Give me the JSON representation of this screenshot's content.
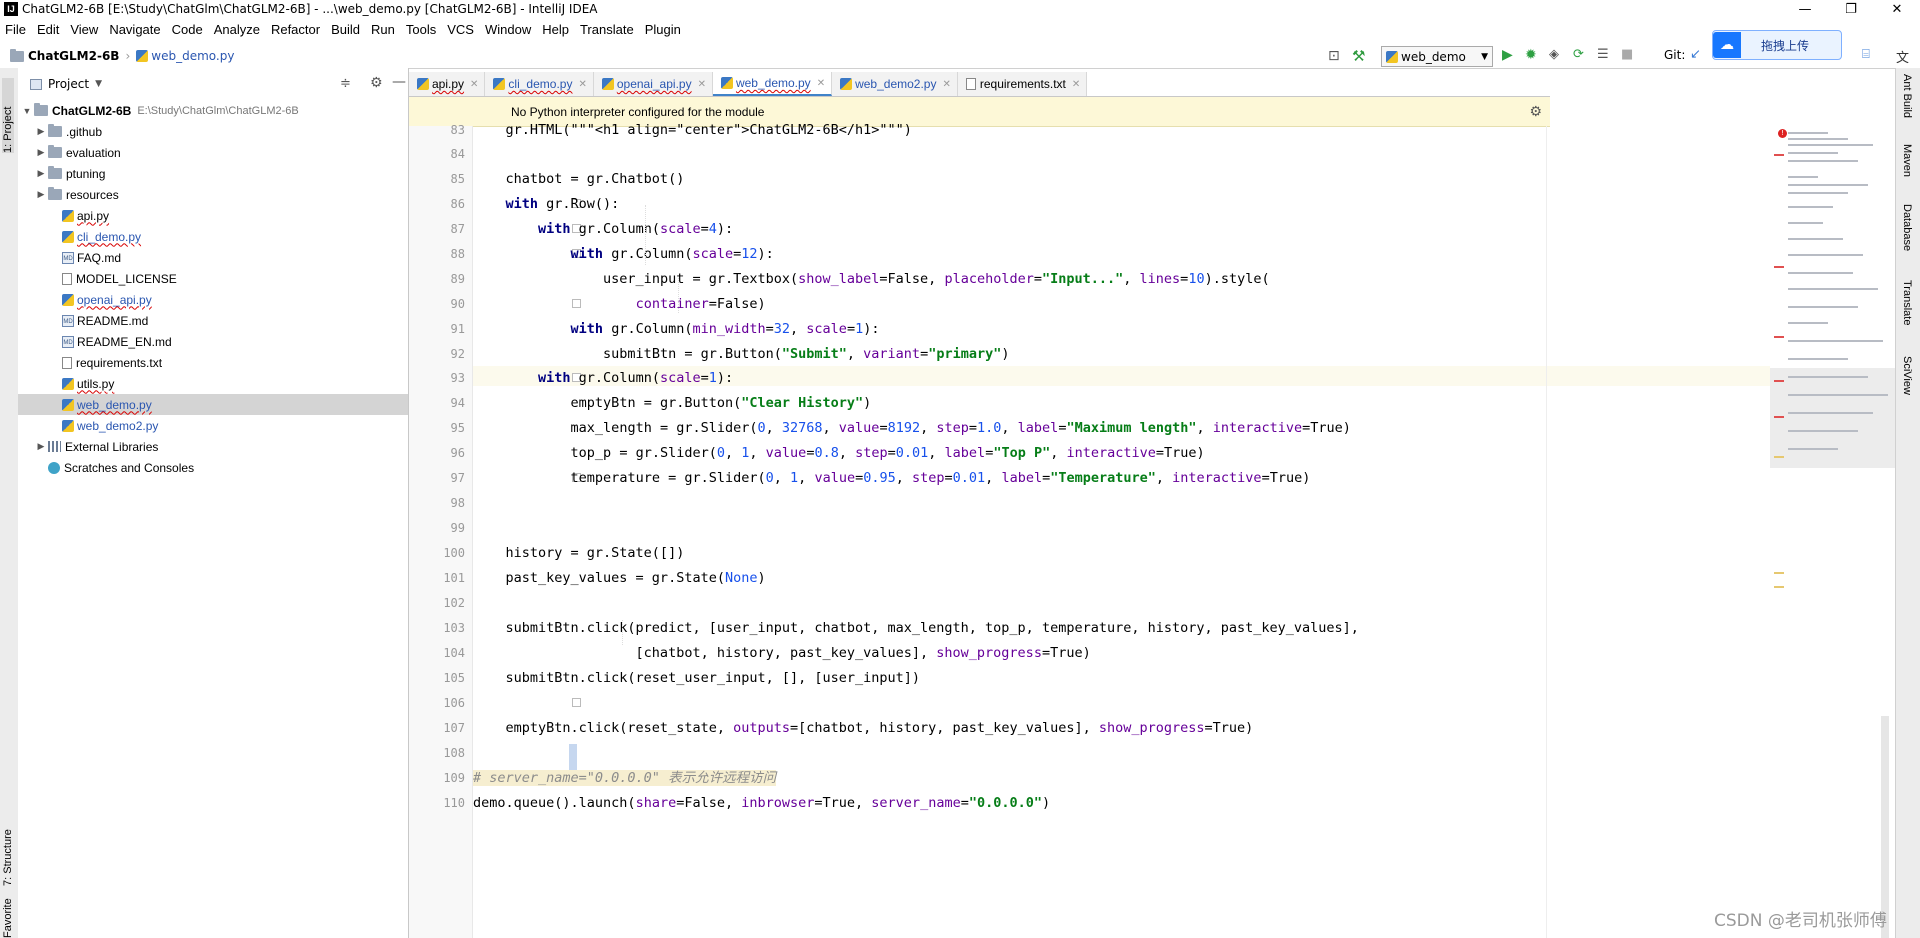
{
  "titlebar": {
    "title": "ChatGLM2-6B [E:\\Study\\ChatGlm\\ChatGLM2-6B] - ...\\web_demo.py [ChatGLM2-6B] - IntelliJ IDEA",
    "minimize": "—",
    "maximize": "❐",
    "close": "✕"
  },
  "menu": [
    "File",
    "Edit",
    "View",
    "Navigate",
    "Code",
    "Analyze",
    "Refactor",
    "Build",
    "Run",
    "Tools",
    "VCS",
    "Window",
    "Help",
    "Translate",
    "Plugin"
  ],
  "navbar": {
    "project": "ChatGLM2-6B",
    "file": "web_demo.py",
    "run_config": "web_demo",
    "git_label": "Git:"
  },
  "upload_badge": {
    "label": "拖拽上传",
    "color": "#1677ff"
  },
  "left_tools": {
    "project": "1: Project",
    "structure": "7: Structure",
    "favorites": "Favorites"
  },
  "right_tools": [
    "Ant Build",
    "Maven",
    "Database",
    "Translate",
    "SciView"
  ],
  "project_panel": {
    "title": "Project",
    "root": {
      "name": "ChatGLM2-6B",
      "path": "E:\\Study\\ChatGlm\\ChatGLM2-6B"
    },
    "items": [
      {
        "name": ".github",
        "type": "folder"
      },
      {
        "name": "evaluation",
        "type": "folder"
      },
      {
        "name": "ptuning",
        "type": "folder"
      },
      {
        "name": "resources",
        "type": "folder"
      },
      {
        "name": "api.py",
        "type": "py"
      },
      {
        "name": "cli_demo.py",
        "type": "py"
      },
      {
        "name": "FAQ.md",
        "type": "md"
      },
      {
        "name": "MODEL_LICENSE",
        "type": "txt"
      },
      {
        "name": "openai_api.py",
        "type": "py"
      },
      {
        "name": "README.md",
        "type": "md"
      },
      {
        "name": "README_EN.md",
        "type": "md"
      },
      {
        "name": "requirements.txt",
        "type": "txt"
      },
      {
        "name": "utils.py",
        "type": "py"
      },
      {
        "name": "web_demo.py",
        "type": "py"
      },
      {
        "name": "web_demo2.py",
        "type": "py"
      }
    ],
    "external_libraries": "External Libraries",
    "scratches": "Scratches and Consoles"
  },
  "tabs": [
    {
      "label": "api.py"
    },
    {
      "label": "cli_demo.py"
    },
    {
      "label": "openai_api.py"
    },
    {
      "label": "web_demo.py",
      "active": true
    },
    {
      "label": "web_demo2.py"
    },
    {
      "label": "requirements.txt"
    }
  ],
  "banner": {
    "text": "No Python interpreter configured for the module"
  },
  "watermark": "CSDN @老司机张师傅",
  "code": {
    "line_numbers": [
      "83",
      "84",
      "85",
      "86",
      "87",
      "88",
      "89",
      "90",
      "91",
      "92",
      "93",
      "94",
      "95",
      "96",
      "97",
      "98",
      "99",
      "100",
      "101",
      "102",
      "103",
      "104",
      "105",
      "106",
      "107",
      "108",
      "109",
      "110"
    ],
    "l83": "    gr.HTML(\"\"\"<h1 align=\"center\">ChatGLM2-6B</h1>\"\"\")",
    "l85": "    chatbot = gr.Chatbot()",
    "l86_kw": "with",
    "l86_rest": " gr.Row():",
    "l87_kw": "with",
    "l87_a": " gr.Column(",
    "l87_p": "scale",
    "l87_eq": "=",
    "l87_n": "4",
    "l87_e": "):",
    "l88_kw": "with",
    "l88_a": " gr.Column(",
    "l88_p": "scale",
    "l88_eq": "=",
    "l88_n": "12",
    "l88_e": "):",
    "l89_a": "user_input = gr.Textbox(",
    "l89_p1": "show_label",
    "l89_b": "=False, ",
    "l89_p2": "placeholder",
    "l89_c": "=",
    "l89_s": "\"Input...\"",
    "l89_d": ", ",
    "l89_p3": "lines",
    "l89_e": "=",
    "l89_n": "10",
    "l89_f": ").style(",
    "l90_p": "container",
    "l90_a": "=False)",
    "l91_kw": "with",
    "l91_a": " gr.Column(",
    "l91_p1": "min_width",
    "l91_eq1": "=",
    "l91_n1": "32",
    "l91_b": ", ",
    "l91_p2": "scale",
    "l91_eq2": "=",
    "l91_n2": "1",
    "l91_e": "):",
    "l92_a": "submitBtn = gr.Button(",
    "l92_s1": "\"Submit\"",
    "l92_b": ", ",
    "l92_p": "variant",
    "l92_c": "=",
    "l92_s2": "\"primary\"",
    "l92_e": ")",
    "l93_kw": "with",
    "l93_a": " gr.Column(",
    "l93_p": "scale",
    "l93_eq": "=",
    "l93_n": "1",
    "l93_e": "):",
    "l94_a": "emptyBtn = gr.Button(",
    "l94_s": "\"Clear History\"",
    "l94_e": ")",
    "l95_a": "max_length = gr.Slider(",
    "l95_n1": "0",
    "l95_b": ", ",
    "l95_n2": "32768",
    "l95_c": ", ",
    "l95_p1": "value",
    "l95_d": "=",
    "l95_n3": "8192",
    "l95_e": ", ",
    "l95_p2": "step",
    "l95_f": "=",
    "l95_n4": "1.0",
    "l95_g": ", ",
    "l95_p3": "label",
    "l95_h": "=",
    "l95_s": "\"Maximum length\"",
    "l95_i": ", ",
    "l95_p4": "interactive",
    "l95_j": "=True)",
    "l96_a": "top_p = gr.Slider(",
    "l96_n1": "0",
    "l96_b": ", ",
    "l96_n2": "1",
    "l96_c": ", ",
    "l96_p1": "value",
    "l96_d": "=",
    "l96_n3": "0.8",
    "l96_e": ", ",
    "l96_p2": "step",
    "l96_f": "=",
    "l96_n4": "0.01",
    "l96_g": ", ",
    "l96_p3": "label",
    "l96_h": "=",
    "l96_s": "\"Top P\"",
    "l96_i": ", ",
    "l96_p4": "interactive",
    "l96_j": "=True)",
    "l97_a": "temperature = gr.Slider(",
    "l97_n1": "0",
    "l97_b": ", ",
    "l97_n2": "1",
    "l97_c": ", ",
    "l97_p1": "value",
    "l97_d": "=",
    "l97_n3": "0.95",
    "l97_e": ", ",
    "l97_p2": "step",
    "l97_f": "=",
    "l97_n4": "0.01",
    "l97_g": ", ",
    "l97_p3": "label",
    "l97_h": "=",
    "l97_s": "\"Temperature\"",
    "l97_i": ", ",
    "l97_p4": "interactive",
    "l97_j": "=True)",
    "l99": "    history = gr.State([])",
    "l100_a": "    past_key_values = gr.State(",
    "l100_n": "None",
    "l100_e": ")",
    "l102": "    submitBtn.click(predict, [user_input, chatbot, max_length, top_p, temperature, history, past_key_values],",
    "l103_a": "                    [chatbot, history, past_key_values], ",
    "l103_p": "show_progress",
    "l103_e": "=True)",
    "l104": "    submitBtn.click(reset_user_input, [], [user_input])",
    "l106_a": "    emptyBtn.click(reset_state, ",
    "l106_p1": "outputs",
    "l106_b": "=[chatbot, history, past_key_values], ",
    "l106_p2": "show_progress",
    "l106_e": "=True)",
    "l108": "# server_name=\"0.0.0.0\" 表示允许远程访问",
    "l109_a": "demo.queue().launch(",
    "l109_p1": "share",
    "l109_b": "=False, ",
    "l109_p2": "inbrowser",
    "l109_c": "=True, ",
    "l109_p3": "server_name",
    "l109_d": "=",
    "l109_s": "\"0.0.0.0\"",
    "l109_e": ")"
  }
}
